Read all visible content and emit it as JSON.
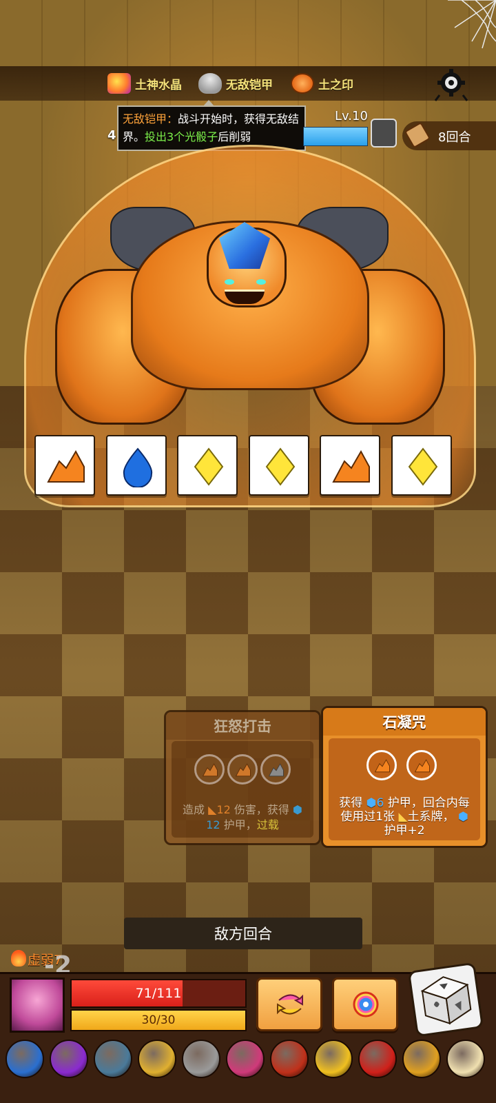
{
  "relics": [
    {
      "name": "土神水晶",
      "icon": "earth-crystal-icon"
    },
    {
      "name": "无敌铠甲",
      "icon": "invincible-armor-icon"
    },
    {
      "name": "土之印",
      "icon": "earth-seal-icon"
    }
  ],
  "tooltip": {
    "title": "无敌铠甲",
    "sep": "：",
    "text1": "战斗开始时，获得无敌结界。",
    "highlight": "投出3个光骰子",
    "text2": "后削弱"
  },
  "enemy": {
    "level": "Lv.10",
    "hp_partial": "4",
    "turns_label": "8回合"
  },
  "dice_rolled": [
    "earth",
    "water",
    "light",
    "light",
    "earth",
    "light"
  ],
  "cards": [
    {
      "title": "狂怒打击",
      "slots": [
        "earth",
        "earth",
        "earth-gray"
      ],
      "desc_prefix": "造成",
      "desc_dmg": "12",
      "desc_mid": "伤害，获得",
      "desc_armor": "12",
      "desc_tail": "护甲，",
      "desc_keyword": "过载"
    },
    {
      "title": "石凝咒",
      "slots": [
        "earth",
        "earth"
      ],
      "line1_a": "获得",
      "line1_armor": "6",
      "line1_b": "护甲，回合内每",
      "line2_a": "使用过1张",
      "line2_b": "土系牌，",
      "line3": "护甲+2"
    }
  ],
  "enemy_turn_label": "敌方回合",
  "status": {
    "weak_label": "虚弱7",
    "damage_pop": "-2"
  },
  "player": {
    "hp": 71,
    "hp_max": 111,
    "hp_text": "71/111",
    "energy": 30,
    "energy_max": 30,
    "energy_text": "30/30"
  },
  "inventory": [
    "crescent-blade-icon",
    "potion-icon",
    "axe-icon",
    "crown-helm-icon",
    "coin-icon",
    "heart-icon",
    "ring-icon",
    "gold-crown-icon",
    "red-dragon-icon",
    "golden-cross-icon",
    "fang-icon"
  ],
  "colors": {
    "accent": "#f5e27a",
    "tooltip_title": "#ffa33a",
    "tooltip_highlight": "#7cf04a",
    "hp": "#e8261c",
    "energy": "#f7bf2a"
  }
}
